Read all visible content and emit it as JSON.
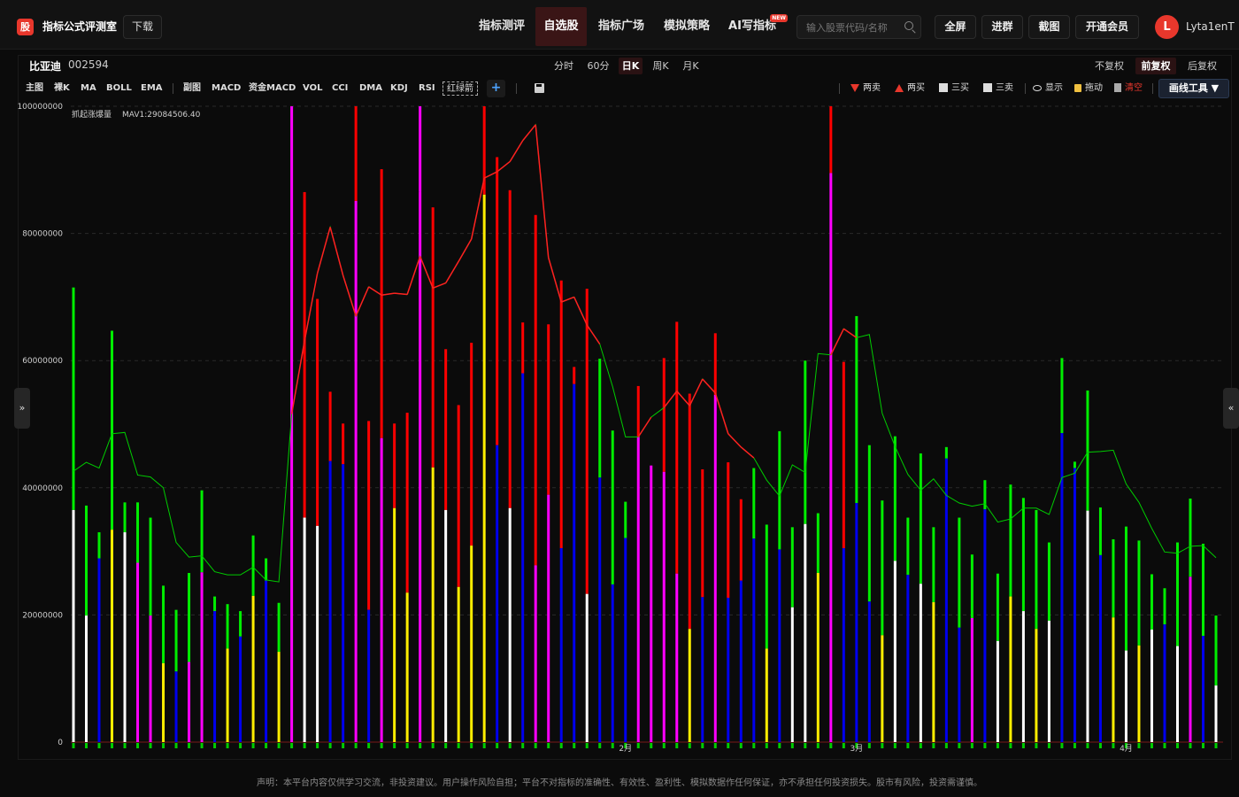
{
  "header": {
    "logo_char": "股",
    "app_title": "指标公式评测室",
    "download_label": "下载",
    "nav": [
      {
        "label": "指标测评",
        "active": false
      },
      {
        "label": "自选股",
        "active": true
      },
      {
        "label": "指标广场",
        "active": false
      },
      {
        "label": "模拟策略",
        "active": false
      },
      {
        "label": "AI写指标",
        "active": false,
        "badge": "NEW"
      }
    ],
    "search_placeholder": "输入股票代码/名称",
    "buttons": [
      "全屏",
      "进群",
      "截图",
      "开通会员"
    ],
    "avatar_letter": "L",
    "username": "Lyta1enT"
  },
  "stock": {
    "name": "比亚迪",
    "code": "002594"
  },
  "periods": [
    {
      "label": "分时",
      "active": false
    },
    {
      "label": "60分",
      "active": false
    },
    {
      "label": "日K",
      "active": true
    },
    {
      "label": "周K",
      "active": false
    },
    {
      "label": "月K",
      "active": false
    }
  ],
  "adjust": [
    {
      "label": "不复权",
      "active": false
    },
    {
      "label": "前复权",
      "active": true
    },
    {
      "label": "后复权",
      "active": false
    }
  ],
  "indicators": [
    "主图",
    "裸K",
    "MA",
    "BOLL",
    "EMA",
    "副图",
    "MACD",
    "资金MACD",
    "VOL",
    "CCI",
    "DMA",
    "KDJ",
    "RSI",
    "红绿箭"
  ],
  "tools": {
    "sell2": "两卖",
    "buy2": "两买",
    "buy3": "三买",
    "sell3": "三卖",
    "show": "显示",
    "drag": "拖动",
    "clear": "清空",
    "draw": "画线工具 ▼"
  },
  "colors": {
    "accent": "#e8372c",
    "background": "#0b0b0b",
    "mav": "#00dd00"
  },
  "chart_data": {
    "type": "bar",
    "series_label": "抓起涨爆量",
    "mav_label": "MAV1:29084506.40",
    "ylim": [
      0,
      100000000
    ],
    "yticks": [
      "100000000",
      "80000000",
      "60000000",
      "40000000",
      "20000000",
      "0"
    ],
    "month_labels": [
      "2月",
      "3月",
      "4月"
    ],
    "values": [
      71500000,
      37200000,
      33000000,
      64700000,
      37700000,
      37700000,
      35300000,
      24600000,
      20800000,
      26600000,
      39600000,
      22900000,
      21700000,
      20600000,
      32500000,
      28900000,
      21900000,
      100000000,
      86500000,
      69700000,
      55100000,
      50100000,
      100000000,
      50500000,
      90100000,
      50100000,
      51800000,
      100000000,
      84100000,
      61800000,
      53000000,
      62800000,
      100000000,
      92000000,
      86800000,
      66000000,
      82900000,
      65700000,
      72600000,
      59000000,
      71300000,
      60300000,
      49000000,
      37800000,
      56000000,
      37800000,
      60400000,
      66100000,
      54800000,
      42900000,
      64300000,
      44000000,
      38200000,
      43100000,
      34200000,
      48900000,
      33800000,
      60000000,
      36000000,
      100000000,
      59800000,
      67000000,
      46700000,
      38000000,
      48100000,
      35300000,
      45400000,
      33800000,
      46400000,
      35300000,
      29500000,
      41200000,
      26500000,
      40500000,
      38400000,
      36500000,
      31400000,
      60400000,
      44100000,
      55300000,
      36900000,
      31900000,
      33900000,
      31700000,
      26400000,
      24200000,
      31400000,
      38300000,
      31200000,
      19900000
    ],
    "lower_segments": [
      36500000,
      19900000,
      28900000,
      33400000,
      33000000,
      28200000,
      19900000,
      12400000,
      11100000,
      12600000,
      26700000,
      20600000,
      14700000,
      16600000,
      23000000,
      25400000,
      14200000,
      50000000,
      35300000,
      34000000,
      44200000,
      43700000,
      85100000,
      20800000,
      47800000,
      36800000,
      23500000,
      86500000,
      43200000,
      36500000,
      24400000,
      30900000,
      86100000,
      46700000,
      36800000,
      58000000,
      27800000,
      38900000,
      30500000,
      56300000,
      23300000,
      41600000,
      24800000,
      32100000,
      48000000,
      43500000,
      42500000,
      26500000,
      17800000,
      22800000,
      54600000,
      22700000,
      25400000,
      32000000,
      14700000,
      30300000,
      21200000,
      34300000,
      26600000,
      89500000,
      30500000,
      37600000,
      22100000,
      16800000,
      28500000,
      26300000,
      24900000,
      22000000,
      44600000,
      18000000,
      19500000,
      36600000,
      15900000,
      22900000,
      20600000,
      17800000,
      19100000,
      48600000,
      43100000,
      36400000,
      29400000,
      19600000,
      14400000,
      15200000,
      17700000,
      18500000,
      15100000,
      26000000,
      16700000,
      8900000
    ],
    "mav_line": [
      42600000,
      44000000,
      43100000,
      48500000,
      48700000,
      42000000,
      41700000,
      40000000,
      31400000,
      29100000,
      29300000,
      26800000,
      26300000,
      26300000,
      27500000,
      25500000,
      25200000,
      51600000,
      63100000,
      73700000,
      81000000,
      73400000,
      67000000,
      71600000,
      70300000,
      70600000,
      70400000,
      76400000,
      71400000,
      72200000,
      75600000,
      79100000,
      88700000,
      89700000,
      91300000,
      94600000,
      97100000,
      76200000,
      69200000,
      70000000,
      65600000,
      62600000,
      55900000,
      48000000,
      48000000,
      51100000,
      52600000,
      55200000,
      52900000,
      57100000,
      54900000,
      48500000,
      46400000,
      44700000,
      41200000,
      38700000,
      43600000,
      42400000,
      61100000,
      60900000,
      65000000,
      63600000,
      64100000,
      51700000,
      46500000,
      42100000,
      39600000,
      41400000,
      38800000,
      37600000,
      37100000,
      37500000,
      34600000,
      35100000,
      36800000,
      36800000,
      35800000,
      41600000,
      42300000,
      45600000,
      45700000,
      45900000,
      40600000,
      37700000,
      33600000,
      29900000,
      29700000,
      30800000,
      30900000,
      29000000
    ],
    "bar_colors": [
      "green",
      "green",
      "green",
      "green",
      "green",
      "green",
      "green",
      "green",
      "green",
      "green",
      "green",
      "green",
      "green",
      "green",
      "green",
      "green",
      "green",
      "magenta",
      "red",
      "red",
      "red",
      "red",
      "red",
      "red",
      "red",
      "red",
      "red",
      "magenta",
      "red",
      "red",
      "red",
      "red",
      "red",
      "red",
      "red",
      "red",
      "red",
      "red",
      "red",
      "red",
      "red",
      "green",
      "green",
      "green",
      "red",
      "green",
      "red",
      "red",
      "red",
      "red",
      "red",
      "red",
      "red",
      "green",
      "green",
      "green",
      "green",
      "green",
      "green",
      "red",
      "red",
      "green",
      "green",
      "green",
      "green",
      "green",
      "green",
      "green",
      "green",
      "green",
      "green",
      "green",
      "green",
      "green",
      "green",
      "green",
      "green",
      "green",
      "green",
      "green",
      "green",
      "green",
      "green",
      "green",
      "green",
      "green",
      "green",
      "green",
      "green",
      "green"
    ],
    "lower_colors": [
      "white",
      "white",
      "blue",
      "yellow",
      "white",
      "magenta",
      "magenta",
      "yellow",
      "blue",
      "magenta",
      "magenta",
      "blue",
      "yellow",
      "blue",
      "yellow",
      "blue",
      "yellow",
      "magenta",
      "white",
      "white",
      "blue",
      "blue",
      "magenta",
      "blue",
      "magenta",
      "yellow",
      "yellow",
      "magenta",
      "yellow",
      "white",
      "yellow",
      "yellow",
      "yellow",
      "blue",
      "white",
      "blue",
      "magenta",
      "magenta",
      "blue",
      "blue",
      "white",
      "blue",
      "blue",
      "blue",
      "magenta",
      "magenta",
      "magenta",
      "magenta",
      "yellow",
      "blue",
      "magenta",
      "blue",
      "blue",
      "blue",
      "yellow",
      "blue",
      "white",
      "white",
      "yellow",
      "magenta",
      "blue",
      "blue",
      "blue",
      "yellow",
      "white",
      "blue",
      "white",
      "yellow",
      "blue",
      "blue",
      "magenta",
      "blue",
      "white",
      "yellow",
      "white",
      "yellow",
      "white",
      "blue",
      "blue",
      "white",
      "blue",
      "yellow",
      "white",
      "yellow",
      "white",
      "blue",
      "white",
      "magenta",
      "blue",
      "white"
    ]
  }
}
